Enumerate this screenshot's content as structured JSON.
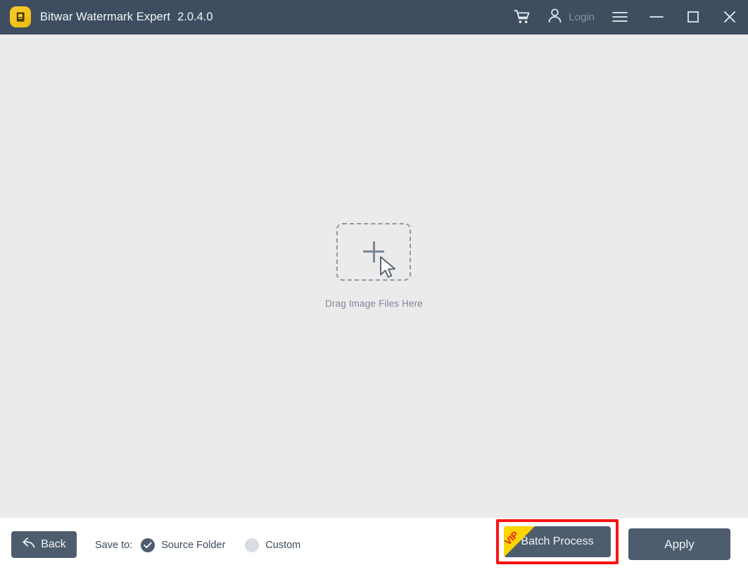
{
  "window": {
    "title": "Bitwar Watermark Expert",
    "version": "2.0.4.0",
    "app_icon": "app-logo-icon",
    "colors": {
      "titlebar_bg": "#3e4e60",
      "content_bg": "#ebebec",
      "footer_bg": "#ffffff",
      "button_bg": "#4e5d6e",
      "accent_yellow": "#f5c518",
      "highlight_red": "#fb1414",
      "muted_text": "#7d8896"
    }
  },
  "titlebar": {
    "cart_icon": "shopping-cart-icon",
    "account_icon": "user-account-icon",
    "login_label": "Login",
    "menu_icon": "hamburger-menu-icon",
    "minimize_icon": "minimize-icon",
    "maximize_icon": "maximize-icon",
    "close_icon": "close-icon"
  },
  "main": {
    "dropzone": {
      "plus_icon": "plus-icon",
      "cursor_icon": "mouse-cursor-arrow-icon",
      "label": "Drag Image Files Here"
    }
  },
  "footer": {
    "back": {
      "label": "Back",
      "icon": "back-arrow-icon"
    },
    "save_to": {
      "label": "Save to:",
      "options": [
        {
          "label": "Source Folder",
          "selected": true
        },
        {
          "label": "Custom",
          "selected": false
        }
      ]
    },
    "batch": {
      "label": "Batch Process",
      "badge": "VIP",
      "highlighted": true
    },
    "apply": {
      "label": "Apply"
    }
  }
}
